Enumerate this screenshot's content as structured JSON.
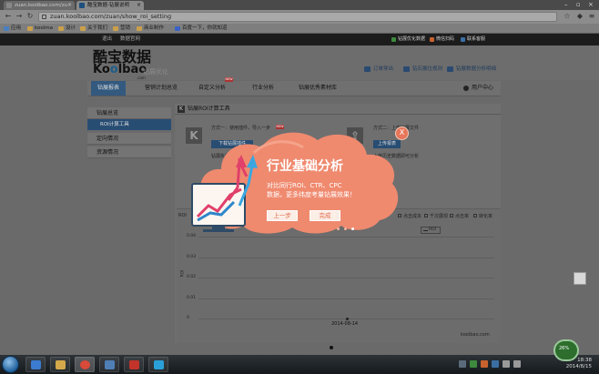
{
  "browser": {
    "tabs": [
      {
        "label": "zuan.koolbao.com/zu",
        "active": false
      },
      {
        "label": "酷宝数据-钻展说明",
        "active": true
      }
    ],
    "url": "zuan.koolbao.com/zuan/show_roi_setting",
    "bookmarks": [
      "应用",
      "koolma",
      "设计",
      "关于我们",
      "营销",
      "商业制作",
      "百度一下，你就知道"
    ]
  },
  "site": {
    "topstrip": {
      "left_links": [
        "退出",
        "数据官网"
      ],
      "buttons": [
        {
          "label": "钻展优化数据",
          "color": "#3d8a3d"
        },
        {
          "label": "微信扫码",
          "color": "#c8622f"
        },
        {
          "label": "联系客服",
          "color": "#3a6fa3"
        }
      ]
    },
    "logo_cn": "酷宝数据",
    "logo_en_pre": "Ko",
    "logo_en_o": "o",
    "logo_en_post": "lbao",
    "logo_domain": ".com",
    "logo_sub": "钻展优化",
    "header_links": [
      "订单导出",
      "钻石展位规则",
      "钻展数据分析明细"
    ],
    "nav": [
      {
        "label": "钻展报表",
        "active": true
      },
      {
        "label": "营销计划总览",
        "active": false
      },
      {
        "label": "自定义分析",
        "active": false,
        "badge": "NEW"
      },
      {
        "label": "行业分析",
        "active": false
      },
      {
        "label": "钻展优秀素材库",
        "active": false
      }
    ],
    "user_center": "用户中心"
  },
  "sidebar": {
    "sections": [
      {
        "label": "钻展总览"
      },
      {
        "label": "ROI计算工具",
        "active": true
      },
      {
        "label": "定向情况"
      },
      {
        "label": "资源情况"
      }
    ]
  },
  "content": {
    "title": "钻展ROI计算工具",
    "method1": "方式一：使用插件，导入一步",
    "method1_badge": "NEW",
    "method1_button": "下载钻展插件",
    "method1_note": "钻展执行中",
    "method2": "方式二：上传钻展文件",
    "method2_button": "上传报表",
    "method2_note": "上传历史数据即可分析",
    "chart_tabs": [
      "ROI",
      "点击成本",
      "千次展现",
      "点击率",
      "转化率"
    ],
    "chart_ylabel": "ROI",
    "chart_watermark": "koolbao.com"
  },
  "chart_data": {
    "type": "line",
    "title": "",
    "xlabel": "",
    "ylabel": "ROI",
    "x": [
      "2014-08-14"
    ],
    "series": [
      {
        "name": "ROI",
        "values": [
          0
        ]
      }
    ],
    "yticks": [
      "0.04",
      "0.03",
      "0.02",
      "0.01",
      "0"
    ],
    "ylim": [
      0,
      0.05
    ],
    "grid": true,
    "legend": "top-right"
  },
  "guide": {
    "title": "行业基础分析",
    "line1": "对比同行ROI、CTR、CPC",
    "line2": "数据，更多纬度考量钻展效果！",
    "prev_button": "上一步",
    "done_button": "完成",
    "close": "X",
    "steps": 3,
    "current_step": 3,
    "colors": {
      "cloud": "#ef8a6f",
      "cloud_light": "#f5a38b",
      "accent": "#e3684a"
    }
  },
  "taskbar": {
    "clock_time": "18:38",
    "clock_date": "2014/8/15",
    "net": "26%"
  }
}
